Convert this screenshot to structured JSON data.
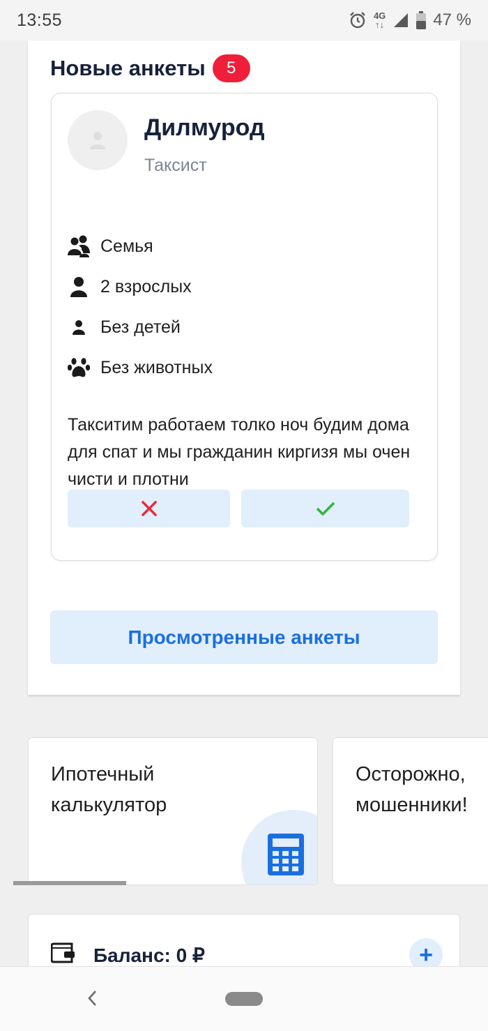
{
  "status_bar": {
    "time": "13:55",
    "network": "4G",
    "battery": "47 %"
  },
  "new_applications": {
    "title": "Новые анкеты",
    "count": "5",
    "applicant": {
      "name": "Дилмурод",
      "occupation": "Таксист",
      "facts": [
        {
          "icon": "family-icon",
          "label": "Семья"
        },
        {
          "icon": "adult-icon",
          "label": "2 взрослых"
        },
        {
          "icon": "child-icon",
          "label": "Без детей"
        },
        {
          "icon": "paw-icon",
          "label": "Без животных"
        }
      ],
      "about": "Такситим работаем толко ноч будим дома для спат и мы гражданин киргизя мы очен чисти и плотни"
    },
    "viewed_button": "Просмотренные анкеты"
  },
  "feature_cards": [
    {
      "title_line1": "Ипотечный",
      "title_line2": "калькулятор",
      "icon": "calculator-icon"
    },
    {
      "title_line1": "Осторожно,",
      "title_line2": "мошенники!"
    }
  ],
  "balance": {
    "label": "Баланс: 0 ₽",
    "add_icon": "+"
  },
  "colors": {
    "accent": "#1a6fe0",
    "badge": "#ef1f3a",
    "reject": "#e8283e",
    "accept": "#2fb83a",
    "button_bg": "#e1eefb"
  }
}
